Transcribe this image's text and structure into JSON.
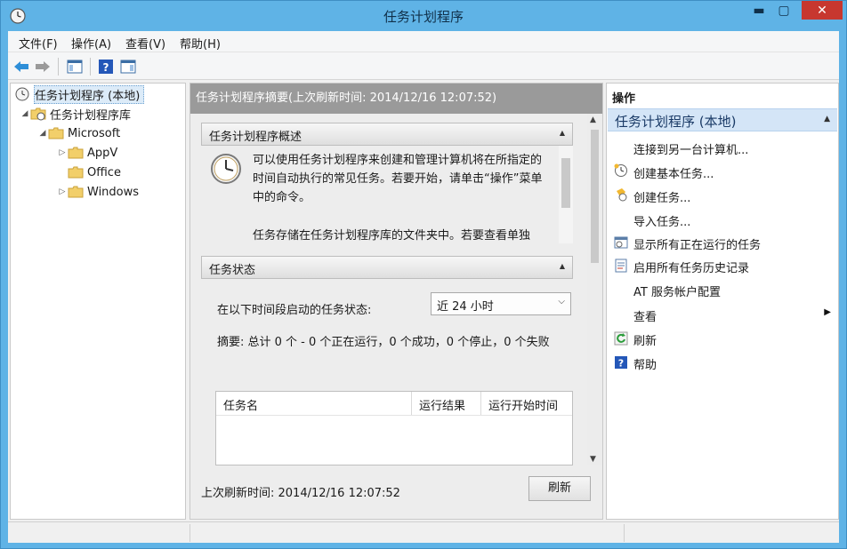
{
  "window": {
    "title": "任务计划程序"
  },
  "menu": [
    "文件(F)",
    "操作(A)",
    "查看(V)",
    "帮助(H)"
  ],
  "tree": {
    "root": "任务计划程序 (本地)",
    "library": "任务计划程序库",
    "microsoft": "Microsoft",
    "children": [
      "AppV",
      "Office",
      "Windows"
    ]
  },
  "center": {
    "header": "任务计划程序摘要(上次刷新时间: 2014/12/16 12:07:52)",
    "overview_title": "任务计划程序概述",
    "overview_text": "可以使用任务计划程序来创建和管理计算机将在所指定的时间自动执行的常见任务。若要开始，请单击“操作”菜单中的命令。",
    "overview_text2": "任务存储在任务计划程序库的文件夹中。若要查看单独",
    "status_title": "任务状态",
    "status_label": "在以下时间段启动的任务状态:",
    "status_select": "近 24 小时",
    "summary": "摘要: 总计 0 个 - 0 个正在运行，0 个成功，0 个停止，0 个失败",
    "table_headers": [
      "任务名",
      "运行结果",
      "运行开始时间"
    ],
    "footer_text": "上次刷新时间: 2014/12/16 12:07:52",
    "refresh_label": "刷新"
  },
  "actions": {
    "title": "操作",
    "group": "任务计划程序 (本地)",
    "items": [
      "连接到另一台计算机...",
      "创建基本任务...",
      "创建任务...",
      "导入任务...",
      "显示所有正在运行的任务",
      "启用所有任务历史记录",
      "AT 服务帐户配置",
      "查看",
      "刷新",
      "帮助"
    ]
  },
  "colors": {
    "titlebar": "#5fb3e6",
    "close": "#c7372f",
    "selection": "#d4e5f7"
  }
}
